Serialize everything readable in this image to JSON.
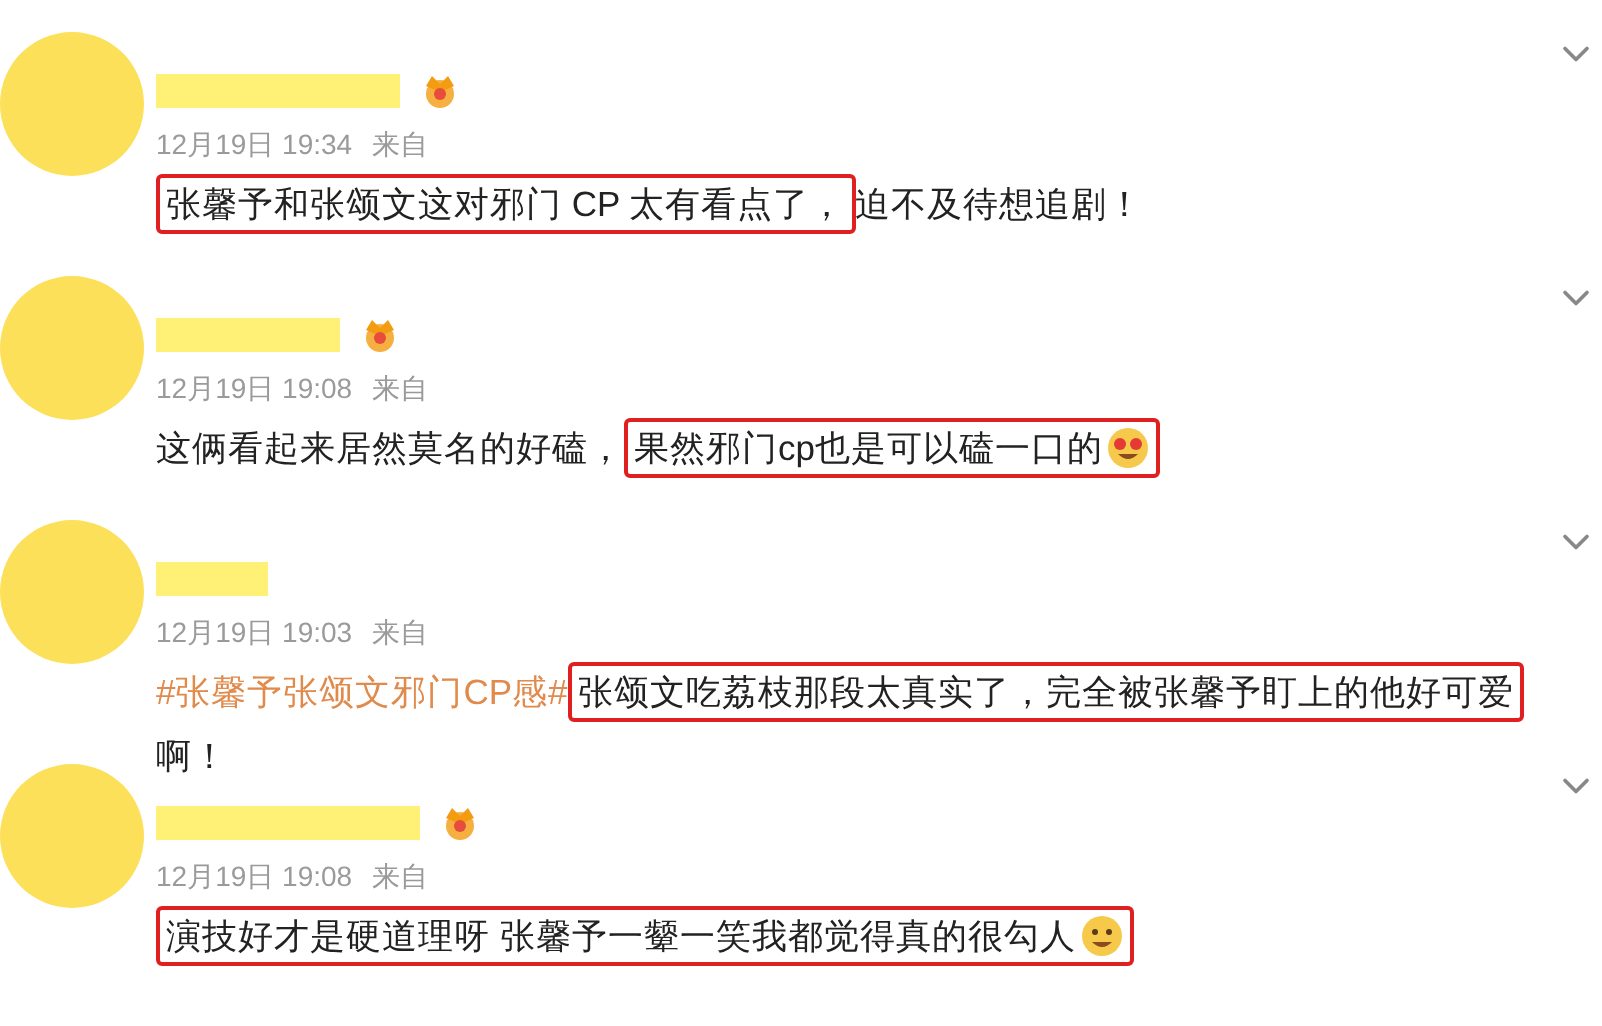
{
  "comments": [
    {
      "badge": true,
      "time": "12月19日 19:34",
      "source_label": "来自",
      "segments": [
        {
          "kind": "text",
          "text": "张馨予和张颂文这对邪门 CP 太有看点了，",
          "highlighted": true
        },
        {
          "kind": "text",
          "text": "迫不及待想追剧！",
          "highlighted": false
        }
      ]
    },
    {
      "badge": true,
      "time": "12月19日 19:08",
      "source_label": "来自",
      "segments": [
        {
          "kind": "text",
          "text": "这俩看起来居然莫名的好磕，",
          "highlighted": false
        },
        {
          "kind": "text",
          "text": "果然邪门cp也是可以磕一口的",
          "highlighted": true,
          "emoji": {
            "kind": "hearts"
          }
        }
      ]
    },
    {
      "badge": false,
      "time": "12月19日 19:03",
      "source_label": "来自",
      "segments": [
        {
          "kind": "hashtag",
          "text": "#张馨予张颂文邪门CP感#",
          "highlighted": false
        },
        {
          "kind": "text",
          "text": "张颂文吃荔枝那段太真实了，完全被张馨予盯上的他好可爱",
          "highlighted": true
        },
        {
          "kind": "text",
          "text": "啊！",
          "highlighted": false
        }
      ]
    },
    {
      "badge": true,
      "time": "12月19日 19:08",
      "source_label": "来自",
      "segments": [
        {
          "kind": "text",
          "text": "演技好才是硬道理呀 张馨予一颦一笑我都觉得真的很勾人",
          "highlighted": true,
          "emoji": {
            "kind": "grin"
          }
        }
      ]
    }
  ]
}
